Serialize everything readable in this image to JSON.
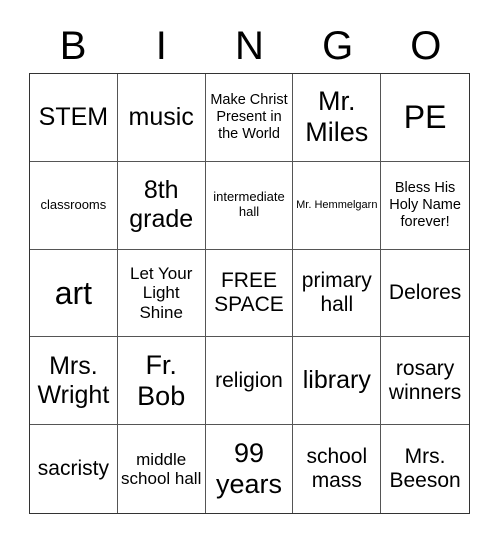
{
  "header": {
    "letters": [
      "B",
      "I",
      "N",
      "G",
      "O"
    ]
  },
  "cells": [
    [
      "STEM",
      "music",
      "Make Christ Present in the World",
      "Mr. Miles",
      "PE"
    ],
    [
      "classrooms",
      "8th grade",
      "intermediate hall",
      "Mr. Hemmelgarn",
      "Bless His Holy Name forever!"
    ],
    [
      "art",
      "Let Your Light Shine",
      "FREE SPACE",
      "primary hall",
      "Delores"
    ],
    [
      "Mrs. Wright",
      "Fr. Bob",
      "religion",
      "library",
      "rosary winners"
    ],
    [
      "sacristy",
      "middle school hall",
      "99 years",
      "school mass",
      "Mrs. Beeson"
    ]
  ]
}
